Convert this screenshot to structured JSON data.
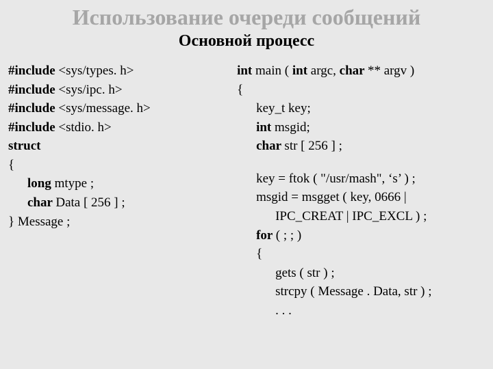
{
  "title": "Использование очереди сообщений",
  "subtitle": "Основной процесс",
  "left": {
    "l1_pre": "#include ",
    "l1_arg": "<sys/types. h>",
    "l2_pre": "#include ",
    "l2_arg": "<sys/ipc. h>",
    "l3_pre": "#include ",
    "l3_arg": "<sys/message. h>",
    "l4_pre": "#include ",
    "l4_arg": "<stdio. h>",
    "l5": "struct",
    "l6": "{",
    "l7_kw": "long ",
    "l7_rest": "mtype ;",
    "l8_kw": "char ",
    "l8_rest": "Data [ 256 ] ;",
    "l9": "} Message ;"
  },
  "right": {
    "r1_kw1": "int ",
    "r1_mid1": "main ( ",
    "r1_kw2": "int ",
    "r1_mid2": "argc, ",
    "r1_kw3": "char ",
    "r1_end": "** argv )",
    "r2": "{",
    "r3": "key_t key;",
    "r4_kw": "int ",
    "r4_rest": "msgid;",
    "r5_kw": "char ",
    "r5_rest": "str [ 256 ] ;",
    "r6": "key = ftok ( \"/usr/mash\", ‘s’ ) ;",
    "r7a": "msgid = msgget ( key, 0666 |",
    "r7b": "IPC_CREAT | IPC_EXCL ) ;",
    "r8_kw": "for ",
    "r8_rest": "( ; ; )",
    "r9": "{",
    "r10": "gets ( str ) ;",
    "r11": "strcpy ( Message . Data, str ) ;",
    "r12": ". . ."
  }
}
